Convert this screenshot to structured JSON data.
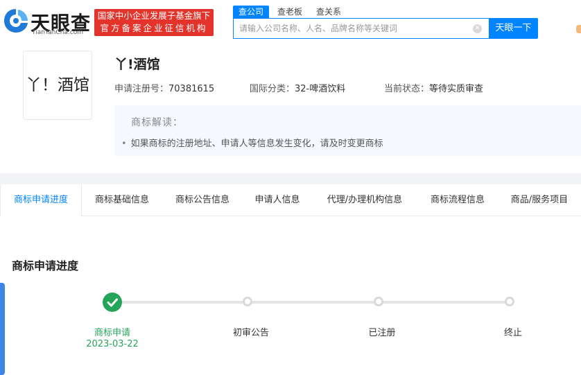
{
  "header": {
    "logo_text": "天眼查",
    "logo_sub": "TianYanCha.com",
    "badge_line1": "国家中小企业发展子基金旗下",
    "badge_line2": "官方备案企业征信机构",
    "search_tabs": [
      "查公司",
      "查老板",
      "查关系"
    ],
    "search_placeholder": "请输入公司名称、人名、品牌名称等关键词",
    "search_button": "天眼一下"
  },
  "trademark": {
    "image_text": "丫！酒馆",
    "name": "丫!酒馆",
    "reg_label": "申请注册号：",
    "reg_value": "70381615",
    "class_label": "国际分类：",
    "class_value": "32-啤酒饮料",
    "status_label": "当前状态：",
    "status_value": "等待实质审查",
    "interpret_title": "商标解读：",
    "interpret_item": "如果商标的注册地址、申请人等信息发生变化，请及时变更商标"
  },
  "tabs": [
    "商标申请进度",
    "商标基础信息",
    "商标公告信息",
    "申请人信息",
    "代理/办理机构信息",
    "商标流程信息",
    "商品/服务项目"
  ],
  "progress": {
    "title": "商标申请进度",
    "steps": [
      {
        "label": "商标申请",
        "date": "2023-03-22",
        "done": true
      },
      {
        "label": "初审公告",
        "done": false
      },
      {
        "label": "已注册",
        "done": false
      },
      {
        "label": "终止",
        "done": false
      }
    ]
  },
  "colors": {
    "accent": "#0084ff",
    "badge": "#e3332b",
    "done": "#25a55a"
  }
}
